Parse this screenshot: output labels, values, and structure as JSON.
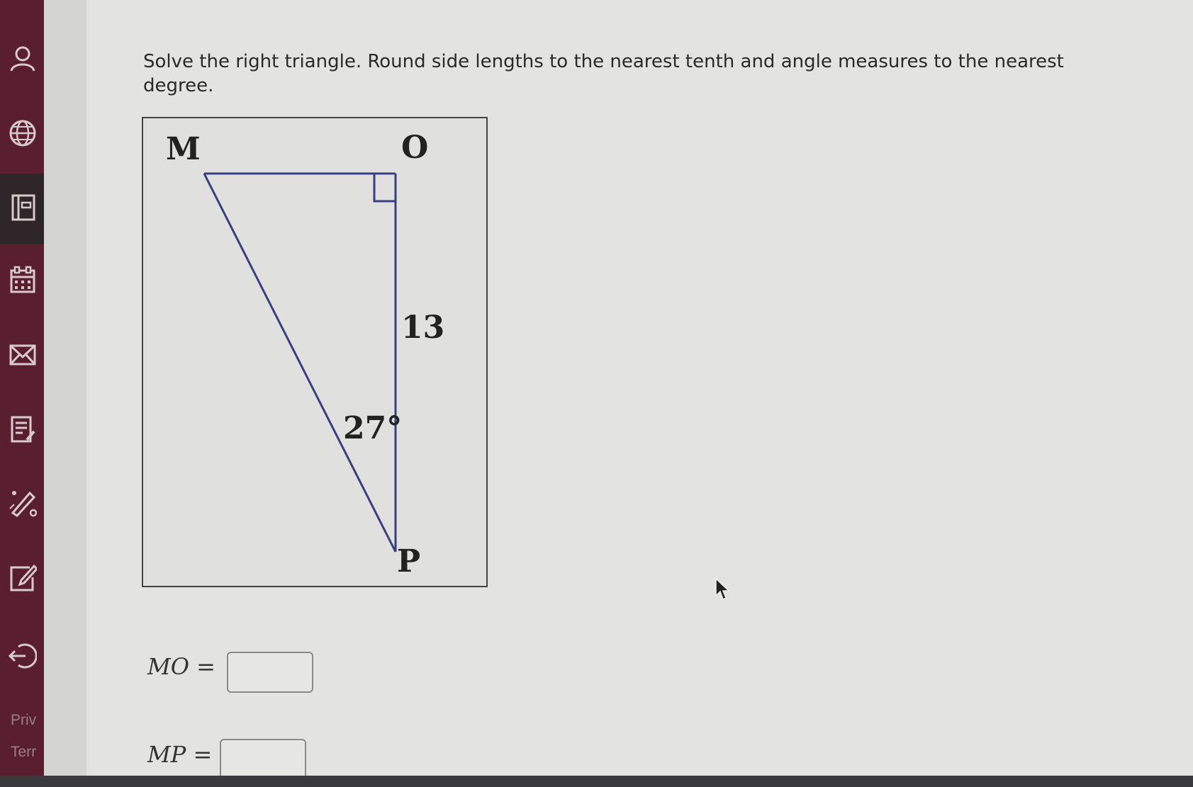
{
  "sidebar": {
    "icons": [
      "user-icon",
      "globe-icon",
      "book-icon",
      "calendar-icon",
      "mail-icon",
      "notes-icon",
      "pencil-tools-icon",
      "edit-icon",
      "logout-icon"
    ],
    "footer_links": [
      "Priv",
      "Terr"
    ]
  },
  "question": {
    "prompt": "Solve the right triangle. Round side lengths to the nearest tenth and angle measures to the nearest degree."
  },
  "figure": {
    "vertex_m": "M",
    "vertex_o": "O",
    "vertex_p": "P",
    "side_op": "13",
    "angle_p": "27°",
    "line_color": "#3a3d80"
  },
  "answers": [
    {
      "label": "MO =",
      "value": ""
    },
    {
      "label": "MP =",
      "value": ""
    }
  ],
  "colors": {
    "sidebar": "#5a1f2e",
    "background": "#e3e3e1"
  }
}
